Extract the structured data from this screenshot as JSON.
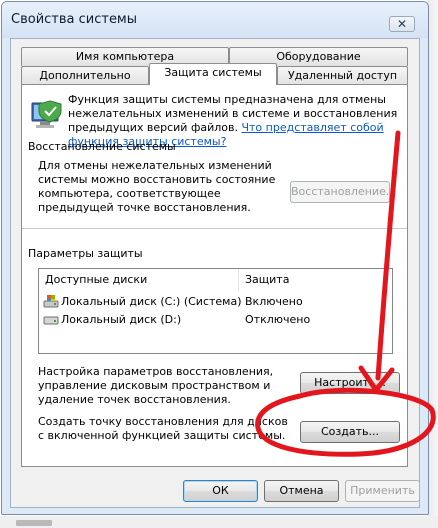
{
  "window": {
    "title": "Свойства системы",
    "close_glyph": "✕"
  },
  "tabs": {
    "row1": [
      {
        "label": "Имя компьютера"
      },
      {
        "label": "Оборудование"
      }
    ],
    "row2": [
      {
        "label": "Дополнительно"
      },
      {
        "label": "Защита системы",
        "active": true
      },
      {
        "label": "Удаленный доступ"
      }
    ]
  },
  "intro": {
    "text": "Функция защиты системы предназначена для отмены нежелательных изменений в системе и восстановления предыдущих версий файлов. ",
    "link": "Что представляет собой функция защиты системы?",
    "icon": "computer-shield-icon"
  },
  "restore": {
    "group_title": "Восстановление системы",
    "description": "Для отмены нежелательных изменений системы можно восстановить состояние компьютера, соответствующее предыдущей точке восстановления.",
    "button_label": "Восстановление..."
  },
  "protection": {
    "group_title": "Параметры защиты",
    "columns": [
      "Доступные диски",
      "Защита"
    ],
    "rows": [
      {
        "drive": "Локальный диск (C:) (Система)",
        "status": "Включено",
        "icon": "system-drive-icon"
      },
      {
        "drive": "Локальный диск (D:)",
        "status": "Отключено",
        "icon": "drive-icon"
      }
    ],
    "configure_text": "Настройка параметров восстановления, управление дисковым пространством и удаление точек восстановления.",
    "configure_button": "Настроить...",
    "create_text": "Создать точку восстановления для дисков с включенной функцией защиты системы.",
    "create_button": "Создать..."
  },
  "footer": {
    "ok": "ОК",
    "cancel": "Отмена",
    "apply": "Применить"
  },
  "annotation": {
    "color": "#e3161d"
  }
}
